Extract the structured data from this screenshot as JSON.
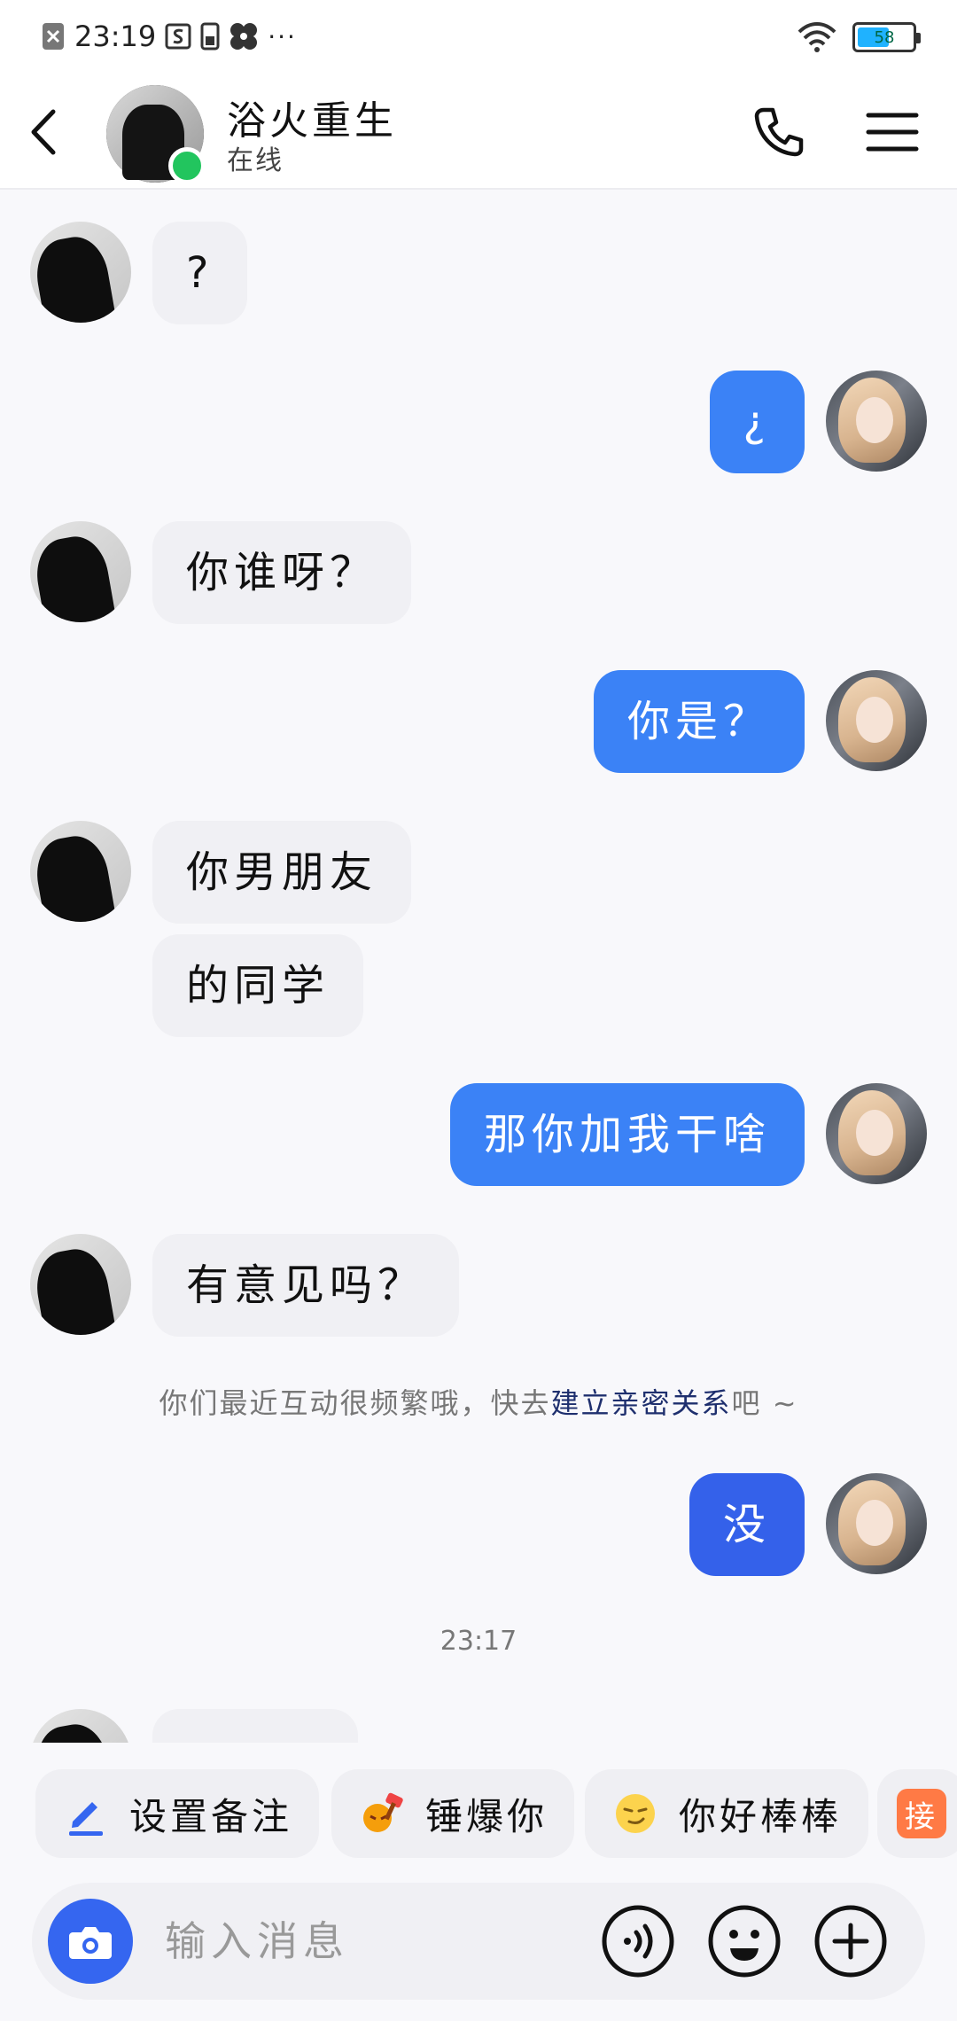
{
  "status_bar": {
    "time": "23:19",
    "dots": "···",
    "battery": "58",
    "battery_level": 0.58,
    "icons": [
      "close-box-icon",
      "s-box-icon",
      "phone-icon",
      "pinwheel-icon",
      "wifi-icon",
      "battery-icon"
    ]
  },
  "header": {
    "name": "浴火重生",
    "status": "在线",
    "online_color": "#22c55e"
  },
  "messages": [
    {
      "side": "in",
      "text": "?"
    },
    {
      "side": "out",
      "text": "¿"
    },
    {
      "side": "in",
      "text": "你谁呀？"
    },
    {
      "side": "out",
      "text": "你是？"
    },
    {
      "side": "in",
      "text": "你男朋友"
    },
    {
      "side": "in",
      "text": "的同学"
    },
    {
      "side": "out",
      "text": "那你加我干啥"
    },
    {
      "side": "in",
      "text": "有意见吗？"
    },
    {
      "side": "out",
      "text": "没"
    }
  ],
  "system_notice": {
    "prefix": "你们最近互动很频繁哦，快去",
    "link": "建立亲密关系",
    "suffix": "吧 ~"
  },
  "timestamp": "23:17",
  "quick_actions": [
    {
      "label": "设置备注",
      "icon": "pencil-icon"
    },
    {
      "label": "锤爆你",
      "icon": "hammer-emoji-icon"
    },
    {
      "label": "你好棒棒",
      "icon": "smirk-emoji-icon"
    },
    {
      "label": "接",
      "icon": "partial-chip"
    }
  ],
  "input": {
    "placeholder": "输入消息"
  },
  "colors": {
    "accent": "#3b82f6",
    "accent_dark": "#3461ea",
    "incoming_bubble": "#f0f0f4",
    "link": "#1e2f6e"
  }
}
